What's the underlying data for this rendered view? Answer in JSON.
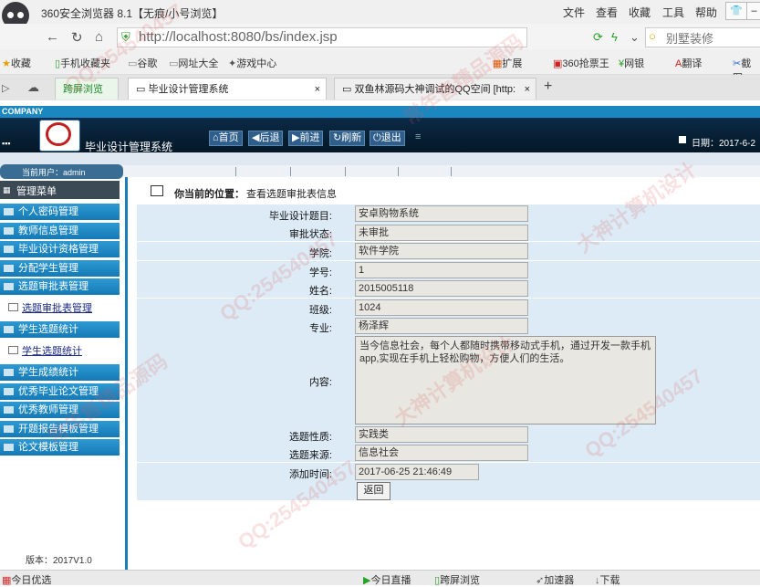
{
  "browser": {
    "title": "360安全浏览器 8.1【无痕/小号浏览】",
    "menus": [
      "文件",
      "查看",
      "收藏",
      "工具",
      "帮助"
    ],
    "url": "http://localhost:8080/bs/index.jsp",
    "search_placeholder": "别墅装修",
    "bookmarks": [
      "收藏",
      "手机收藏夹",
      "谷歌",
      "网址大全",
      "游戏中心",
      "扩展",
      "360抢票王",
      "网银",
      "翻译",
      "截图"
    ],
    "tab_promo": "跨屏浏览",
    "tabs": [
      "毕业设计管理系统",
      "双鱼林源码大神调试的QQ空间 [http:"
    ]
  },
  "app": {
    "company": "COMPANY",
    "title": "毕业设计管理系统",
    "nav": [
      "首页",
      "后退",
      "前进",
      "刷新",
      "退出"
    ],
    "date_label": "日期：2017-6-2",
    "current_user": "当前用户：admin",
    "menu_title": "管理菜单",
    "version": "版本：2017V1.0"
  },
  "sidebar": {
    "items": [
      "个人密码管理",
      "教师信息管理",
      "毕业设计资格管理",
      "分配学生管理",
      "选题审批表管理"
    ],
    "sub1": "选题审批表管理",
    "group2": "学生选题统计",
    "sub2": "学生选题统计",
    "items2": [
      "学生成绩统计",
      "优秀毕业论文管理",
      "优秀教师管理",
      "开题报告模板管理",
      "论文模板管理"
    ]
  },
  "location": {
    "label": "你当前的位置：",
    "value": "查看选题审批表信息"
  },
  "form": {
    "fields": [
      {
        "label": "毕业设计题目:",
        "value": "安卓购物系统"
      },
      {
        "label": "审批状态:",
        "value": "未审批"
      },
      {
        "label": "学院:",
        "value": "软件学院"
      },
      {
        "label": "学号:",
        "value": "1"
      },
      {
        "label": "姓名:",
        "value": "2015005118"
      },
      {
        "label": "班级:",
        "value": "1024"
      },
      {
        "label": "专业:",
        "value": "杨泽辉"
      }
    ],
    "content_label": "内容:",
    "content_value": "当今信息社会，每个人都随时携带移动式手机，通过开发一款手机app,实现在手机上轻松购物，方便人们的生活。",
    "fields2": [
      {
        "label": "选题性质:",
        "value": "实践类"
      },
      {
        "label": "选题来源:",
        "value": "信息社会"
      },
      {
        "label": "添加时间:",
        "value": "2017-06-25 21:46:49"
      }
    ],
    "back_label": "返回"
  },
  "status": {
    "left": "今日优选",
    "items": [
      "今日直播",
      "跨屏浏览",
      "加速器",
      "下载"
    ]
  },
  "watermarks": [
    "QQ:254540457",
    "常年售精品源码",
    "大神计算机设计",
    "QQ:254540457",
    "常年售精品源码",
    "大神计算机设计",
    "QQ:254540457",
    "QQ:254540457"
  ]
}
